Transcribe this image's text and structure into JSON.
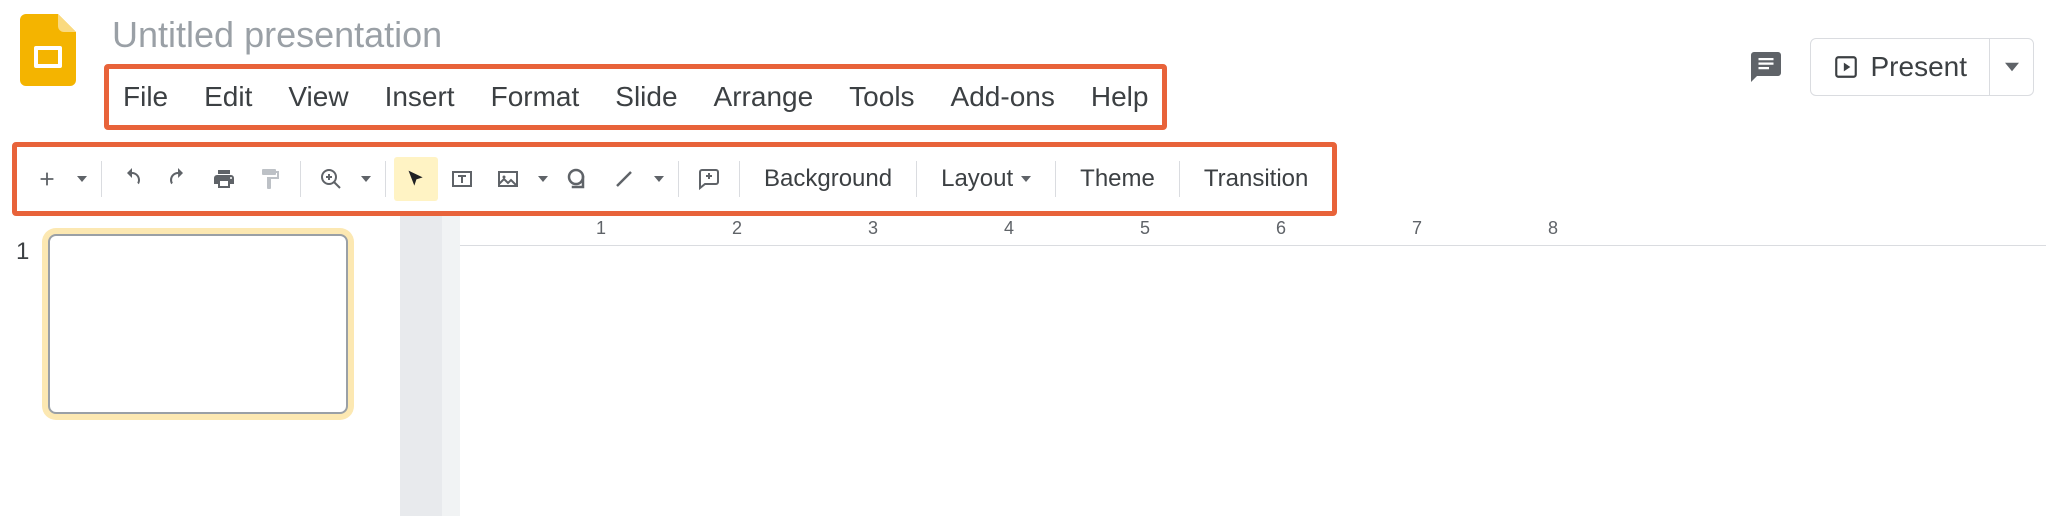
{
  "header": {
    "title": "Untitled presentation",
    "present_label": "Present"
  },
  "menubar": {
    "items": [
      "File",
      "Edit",
      "View",
      "Insert",
      "Format",
      "Slide",
      "Arrange",
      "Tools",
      "Add-ons",
      "Help"
    ]
  },
  "toolbar": {
    "background_label": "Background",
    "layout_label": "Layout",
    "theme_label": "Theme",
    "transition_label": "Transition"
  },
  "filmstrip": {
    "slides": [
      {
        "number": "1"
      }
    ]
  },
  "ruler": {
    "marks": [
      "1",
      "2",
      "3",
      "4",
      "5",
      "6",
      "7",
      "8"
    ]
  },
  "colors": {
    "highlight_border": "#e8633a",
    "selection_bg": "#fce8b2",
    "brand_yellow": "#f4b400"
  }
}
